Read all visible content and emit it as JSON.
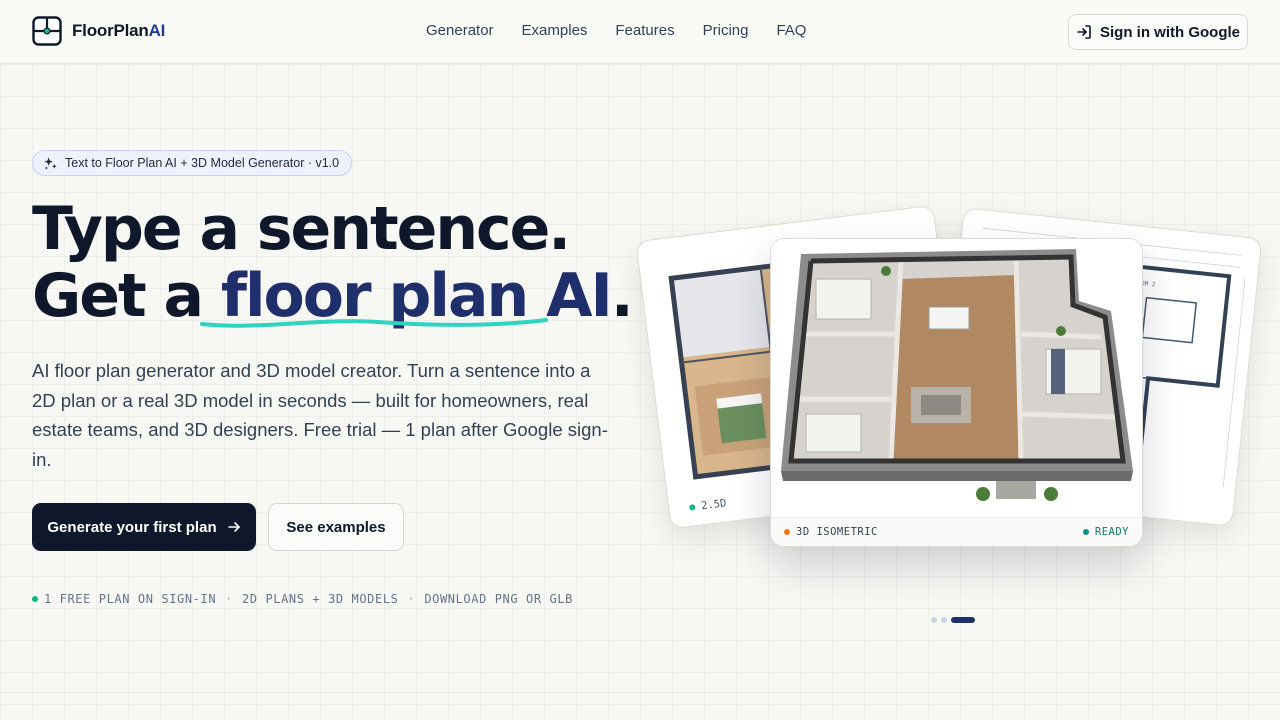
{
  "header": {
    "logo_main": "FloorPlan",
    "logo_accent": "AI",
    "nav": [
      "Generator",
      "Examples",
      "Features",
      "Pricing",
      "FAQ"
    ],
    "signin_label": "Sign in with Google"
  },
  "hero": {
    "badge": "Text to Floor Plan AI + 3D Model Generator · v1.0",
    "headline_line1": "Type a sentence.",
    "headline_line2_prefix": "Get a ",
    "headline_line2_accent": "floor plan AI",
    "headline_line2_suffix": ".",
    "lead": "AI floor plan generator and 3D model creator. Turn a sentence into a 2D plan or a real 3D model in seconds — built for homeowners, real estate teams, and 3D designers. Free trial — 1 plan after Google sign-in.",
    "primary_cta": "Generate your first plan",
    "secondary_cta": "See examples",
    "features": [
      "1 FREE PLAN ON SIGN-IN",
      "2D PLANS + 3D MODELS",
      "DOWNLOAD PNG OR GLB"
    ]
  },
  "preview": {
    "left_card_tag": "2.5D",
    "main_card_label": "3D ISOMETRIC",
    "main_card_status": "READY",
    "accent_dot_color": "#f97316",
    "ready_dot_color": "#0d9488",
    "pager_count": 3,
    "pager_active_index": 2
  }
}
